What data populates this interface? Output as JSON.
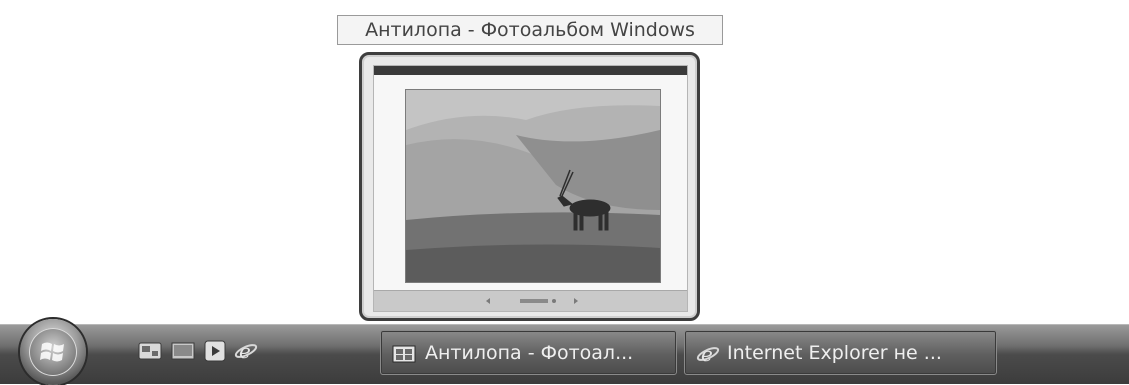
{
  "tooltip": {
    "text": "Антилопа - Фотоальбом Windows"
  },
  "thumbnail": {
    "statusbar_text": "‹   ◦◦◦◦◦◦   ›"
  },
  "taskbar": {
    "quick_launch": [
      {
        "icon": "show-desktop-icon"
      },
      {
        "icon": "switch-windows-icon"
      },
      {
        "icon": "media-player-icon"
      },
      {
        "icon": "internet-explorer-icon"
      }
    ],
    "buttons": [
      {
        "label": "Антилопа - Фотоал...",
        "icon": "photo-gallery-icon",
        "active": true
      },
      {
        "label": "Internet Explorer не ...",
        "icon": "internet-explorer-icon",
        "active": false
      }
    ]
  },
  "colors": {
    "taskbar_dark": "#3c3c3c",
    "taskbar_light": "#9a9a9a",
    "tooltip_bg": "#f4f4f4",
    "thumb_border": "#3e3e3e"
  }
}
